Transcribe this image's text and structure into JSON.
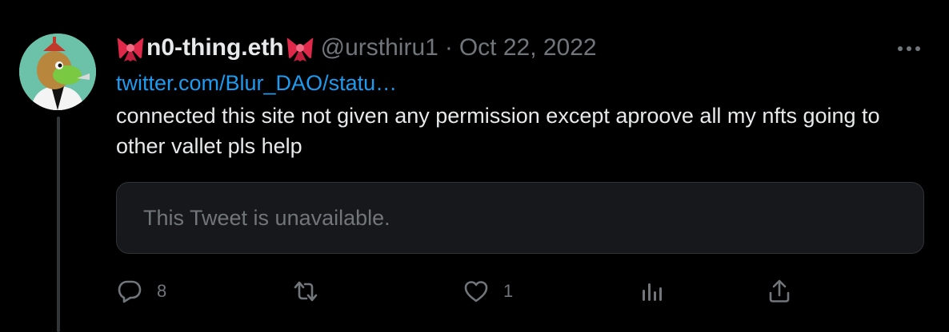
{
  "tweet": {
    "author": {
      "display_name": "n0-thing.eth",
      "name_emoji": "ribbon-emoji",
      "handle": "@ursthiru1"
    },
    "separator": "·",
    "date": "Oct 22, 2022",
    "link_text": "twitter.com/Blur_DAO/statu…",
    "text": "connected this site not given any permission except aproove all my nfts going to other vallet pls help",
    "quoted_tweet": {
      "message": "This Tweet is unavailable."
    },
    "actions": {
      "reply_count": "8",
      "like_count": "1"
    }
  },
  "colors": {
    "background": "#000000",
    "text_primary": "#e7e9ea",
    "text_secondary": "#71767b",
    "link": "#1d9bf0",
    "card_background": "#16181c",
    "card_border": "#2f3336",
    "ribbon": "#e0284a"
  },
  "icons": [
    "more-icon",
    "reply-icon",
    "retweet-icon",
    "like-icon",
    "analytics-icon",
    "share-icon"
  ]
}
